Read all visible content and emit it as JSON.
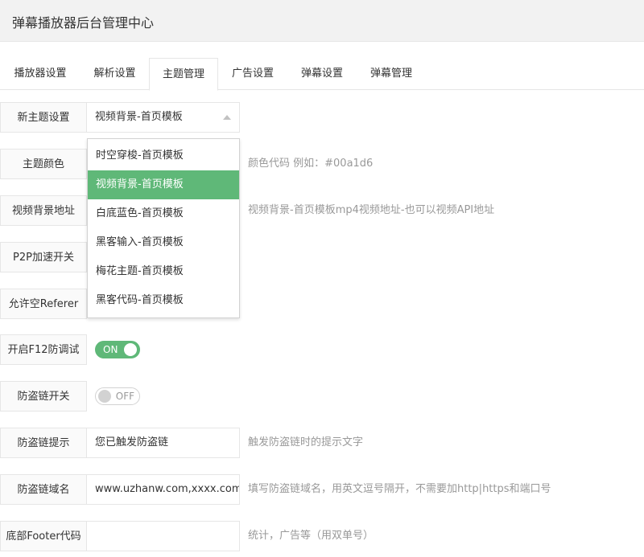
{
  "header": {
    "title": "弹幕播放器后台管理中心"
  },
  "tabs": [
    {
      "label": "播放器设置"
    },
    {
      "label": "解析设置"
    },
    {
      "label": "主题管理"
    },
    {
      "label": "广告设置"
    },
    {
      "label": "弹幕设置"
    },
    {
      "label": "弹幕管理"
    }
  ],
  "active_tab": "主题管理",
  "form": {
    "theme": {
      "label": "新主题设置",
      "value": "视频背景-首页模板"
    },
    "color": {
      "label": "主题颜色",
      "hint": "颜色代码 例如：#00a1d6"
    },
    "video_bg": {
      "label": "视频背景地址",
      "hint": "视频背景-首页模板mp4视频地址-也可以视频API地址"
    },
    "p2p": {
      "label": "P2P加速开关"
    },
    "referer": {
      "label": "允许空Referer"
    },
    "f12": {
      "label": "开启F12防调试",
      "switch_text": "ON",
      "state": "on"
    },
    "hotlink": {
      "label": "防盗链开关",
      "switch_text": "OFF",
      "state": "off"
    },
    "hotlink_tip": {
      "label": "防盗链提示",
      "value": "您已触发防盗链",
      "hint": "触发防盗链时的提示文字"
    },
    "hotlink_domain": {
      "label": "防盗链域名",
      "value": "www.uzhanw.com,xxxx.com",
      "hint": "填写防盗链域名，用英文逗号隔开，不需要加http|https和端口号"
    },
    "footer": {
      "label": "底部Footer代码",
      "value": "",
      "hint": "统计，广告等（用双单号）"
    }
  },
  "dropdown": {
    "options": [
      "时空穿梭-首页模板",
      "视频背景-首页模板",
      "白底蓝色-首页模板",
      "黑客输入-首页模板",
      "梅花主题-首页模板",
      "黑客代码-首页模板"
    ],
    "selected": "视频背景-首页模板"
  },
  "colors": {
    "accent": "#5fb878",
    "border": "#e6e6e6",
    "header_bg": "#f2f2f2",
    "hint": "#999999"
  }
}
